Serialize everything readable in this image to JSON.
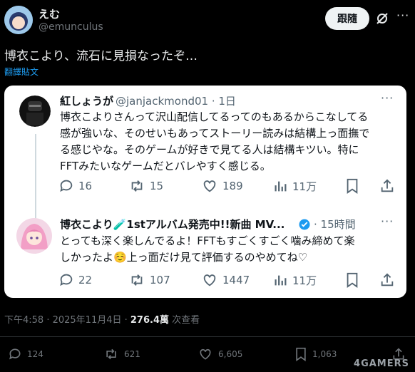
{
  "post": {
    "author_name": "えむ",
    "author_handle": "@emunculus",
    "follow_label": "跟隨",
    "text": "博衣こより、流石に見損なったぞ…",
    "translate_label": "翻譯貼文",
    "timestamp": "下午4:58 · 2025年11月4日 · ",
    "views_count": "276.4萬",
    "views_label": " 次查看",
    "actions": {
      "replies": "124",
      "reposts": "621",
      "likes": "6,605",
      "bookmarks": "1,063"
    }
  },
  "quoted_thread": [
    {
      "name": "紅しょうが",
      "handle": "@janjackmond01",
      "time": "1日",
      "text_lines": [
        "博衣こよりさんって沢山配信してるってのもあるからこなしてる",
        "感が強いな、そのせいもあってストーリー読みは結構上っ面撫で",
        "る感じやな。そのゲームが好きで見てる人は結構キツい。特に",
        "FFTみたいなゲームだとバレやすく感じる。"
      ],
      "replies": "16",
      "reposts": "15",
      "likes": "189",
      "views": "11万"
    },
    {
      "name": "博衣こより🧪1stアルバム発売中!!新曲 MV...",
      "time": "15時間",
      "text_lines": [
        "とっても深く楽しんでるよ！FFTもすごくすごく噛み締めて楽",
        "しかったよ☺️上っ面だけ見て評価するのやめてね♡"
      ],
      "replies": "22",
      "reposts": "107",
      "likes": "1447",
      "views": "11万"
    }
  ],
  "watermark": "4GAMERS",
  "colors": {
    "accent": "#1d9bf0",
    "bg": "#000000",
    "card_bg": "#ffffff",
    "muted": "#71767b",
    "verified": "#1d9bf0"
  }
}
